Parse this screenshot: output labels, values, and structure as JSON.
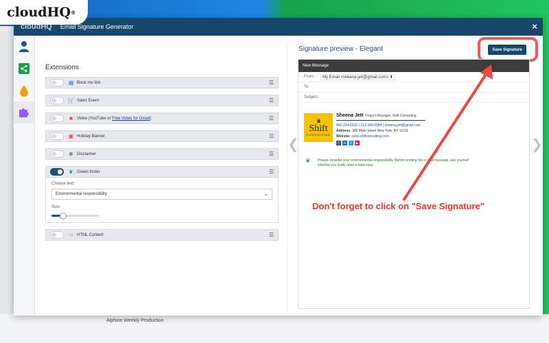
{
  "brand": {
    "name": "cloudHQ",
    "mark": "®"
  },
  "modal": {
    "header_brand": "cloudHQ",
    "title": "Email Signature Generator",
    "close": "×"
  },
  "extensions": {
    "title": "Extensions",
    "items": [
      {
        "label": "Book me link",
        "icon": "calendar-icon",
        "color": "#3b82f6",
        "on": false
      },
      {
        "label": "Sales Event",
        "icon": "cart-icon",
        "color": "#f97316",
        "on": false
      },
      {
        "label_prefix": "Video (YouTube or ",
        "label_link": "Free Video for Gmail",
        "label_suffix": ")",
        "icon": "video-icon",
        "color": "#ef4444",
        "on": false
      },
      {
        "label": "Holiday Banner",
        "icon": "gift-icon",
        "color": "#ef4444",
        "on": false
      },
      {
        "label": "Disclaimer",
        "icon": "globe-icon",
        "color": "#555555",
        "on": false
      },
      {
        "label": "Green footer",
        "icon": "leaf-icon",
        "color": "#16a34a",
        "on": true
      },
      {
        "label": "HTML Content",
        "icon": "code-icon",
        "color": "#f97316",
        "on": false
      }
    ],
    "green_panel": {
      "choose_text_label": "Choose text:",
      "selected": "Environmental responsibility",
      "size_label": "Size:",
      "size_value": 0.2
    }
  },
  "preview": {
    "title": "Signature preview - Elegant",
    "save_label": "Save Signature",
    "email_header": "New Message",
    "from_label": "From",
    "from_value": "My Email <sheena.jett@gmail.com> ⬍",
    "to_label": "To",
    "subject_label": "Subject",
    "signature": {
      "logo_word": "Shift",
      "logo_sub": "CONSULTING",
      "name": "Sheena Jett",
      "role": "Project Manager, Shift Consulting",
      "phones": "800-234-6532 | 213-349-6984 | sheena.jett@gmail.com",
      "address_label": "Address:",
      "address": "386 Main Street New York, NY 11211",
      "website_label": "Website:",
      "website": "www.shiftconsulting.com",
      "green_note": "Please consider your environmental responsibility. Before printing this e-mail message, ask yourself whether you really need a hard copy."
    },
    "social": [
      {
        "name": "facebook-icon",
        "glyph": "f",
        "color": "#3b5998"
      },
      {
        "name": "linkedin-icon",
        "glyph": "in",
        "color": "#0077b5"
      },
      {
        "name": "twitter-icon",
        "glyph": "t",
        "color": "#1da1f2"
      },
      {
        "name": "youtube-icon",
        "glyph": "▶",
        "color": "#cc2222"
      }
    ]
  },
  "callout": "Don't forget to click on \"Save Signature\"",
  "background": {
    "footer_text": "Alphine     Weekly Production"
  }
}
